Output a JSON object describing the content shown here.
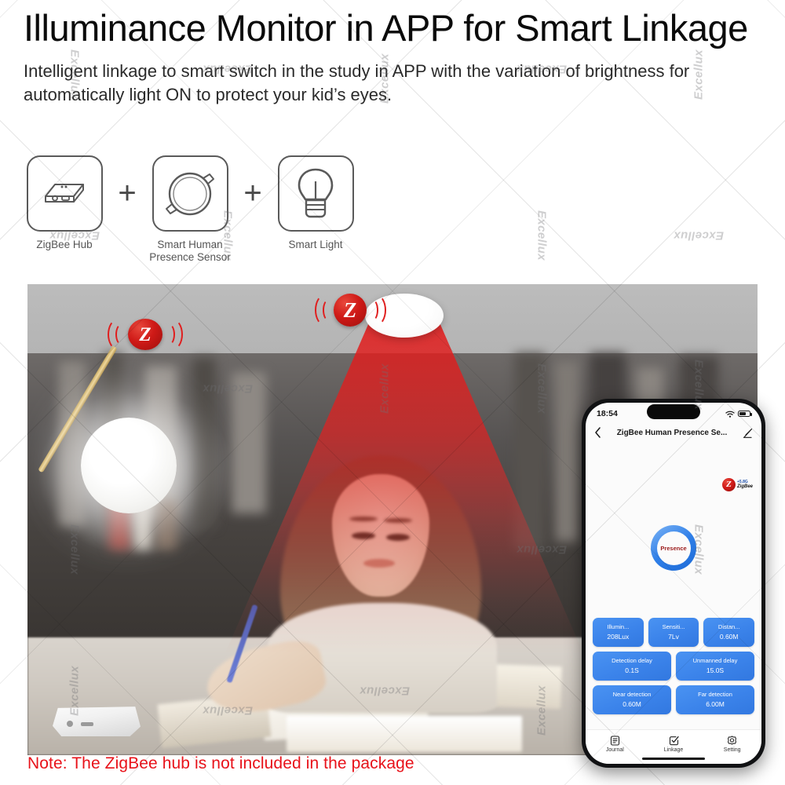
{
  "header": {
    "title": "Illuminance Monitor in APP for Smart Linkage",
    "subtitle": "Intelligent linkage to smart switch in the study in APP with the variation of brightness for automatically light ON to protect your kid’s eyes."
  },
  "products": [
    {
      "icon": "zigbee-hub-icon",
      "label": "ZigBee Hub"
    },
    {
      "icon": "presence-sensor-icon",
      "label": "Smart Human\nPresence Sensor"
    },
    {
      "icon": "light-bulb-icon",
      "label": "Smart Light"
    }
  ],
  "plus_symbol": "+",
  "scene": {
    "ceiling_sensor": "ceiling-presence-sensor",
    "zigbee_badge_letter": "Z",
    "hub_badge_letter": "Z",
    "detection_cone_color": "#e21a1a"
  },
  "phone": {
    "status": {
      "time": "18:54",
      "wifi": "wifi-icon",
      "battery": "battery-icon"
    },
    "nav": {
      "back": "back-chevron-icon",
      "title": "ZigBee Human Presence Se...",
      "edit": "pencil-icon"
    },
    "logo": {
      "tag": "+5.8G",
      "name": "ZigBee",
      "letter": "Z"
    },
    "presence": {
      "label": "Presence",
      "ring_color": "#2f7fe8",
      "text_color": "#9b1b1b"
    },
    "tiles": [
      [
        {
          "label": "Illumin...",
          "value": "208Lux"
        },
        {
          "label": "Sensiti...",
          "value": "7Lv"
        },
        {
          "label": "Distan...",
          "value": "0.60M"
        }
      ],
      [
        {
          "label": "Detection delay",
          "value": "0.1S"
        },
        {
          "label": "Unmanned delay",
          "value": "15.0S"
        }
      ],
      [
        {
          "label": "Near detection",
          "value": "0.60M"
        },
        {
          "label": "Far detection",
          "value": "6.00M"
        }
      ]
    ],
    "tabs": [
      {
        "icon": "journal-icon",
        "label": "Journal"
      },
      {
        "icon": "linkage-icon",
        "label": "Linkage"
      },
      {
        "icon": "gear-icon",
        "label": "Setting"
      }
    ]
  },
  "note": "Note: The ZigBee hub is not included in the package",
  "watermark": {
    "text": "Excellux"
  }
}
